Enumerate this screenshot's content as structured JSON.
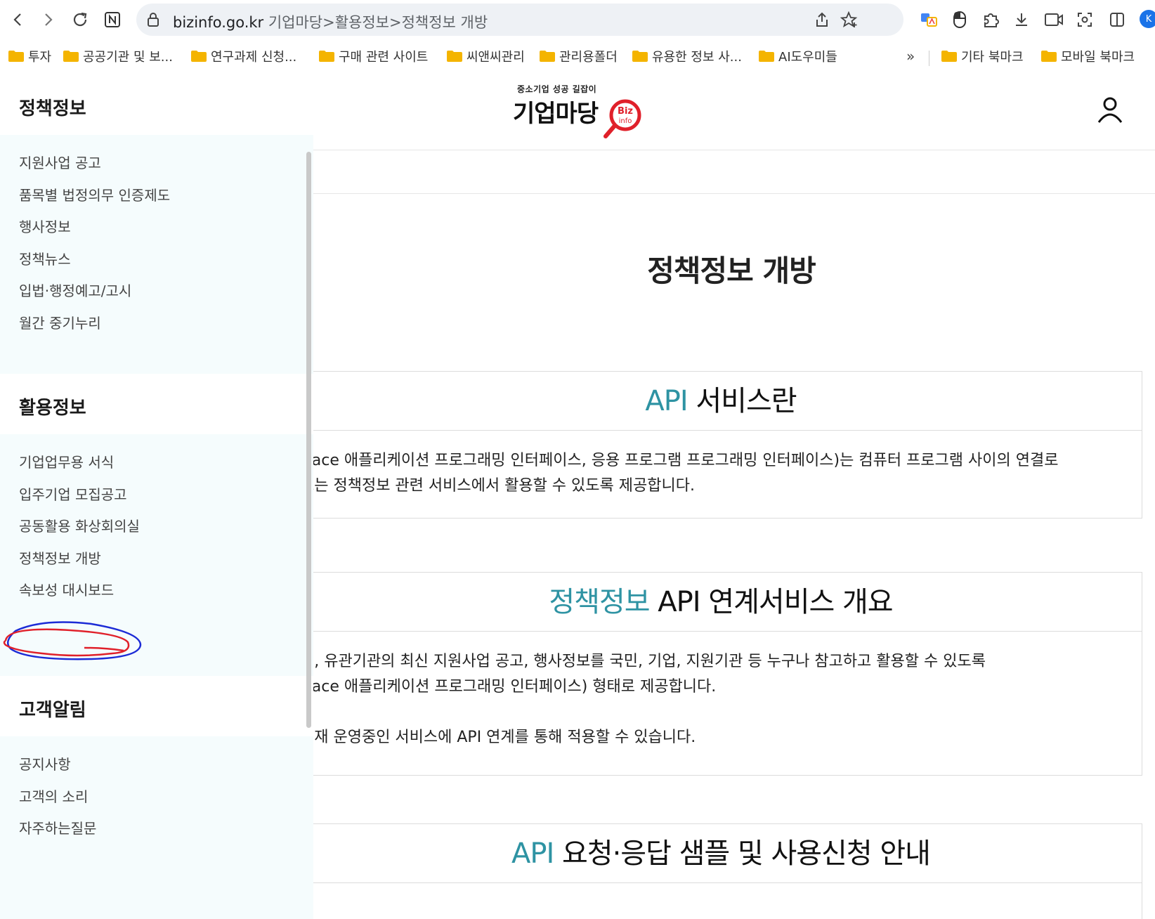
{
  "browser": {
    "url_host": "bizinfo.go.kr",
    "url_path": " 기업마당>활용정보>정책정보 개방",
    "profile_initial": "K",
    "bookmarks": [
      {
        "label": "투자"
      },
      {
        "label": "공공기관 및 보..."
      },
      {
        "label": "연구과제 신청..."
      },
      {
        "label": "구매 관련 사이트"
      },
      {
        "label": "씨앤씨관리"
      },
      {
        "label": "관리용폴더"
      },
      {
        "label": "유용한 정보 사..."
      },
      {
        "label": "AI도우미들"
      }
    ],
    "more_label": "»",
    "other_bookmarks": "기타 북마크",
    "mobile_bookmarks": "모바일 북마크",
    "folder_color": "#f4b400"
  },
  "sidebar": {
    "sections": [
      {
        "title": "정책정보",
        "items": [
          "지원사업 공고",
          "품목별 법정의무 인증제도",
          "행사정보",
          "정책뉴스",
          "입법·행정예고/고시",
          "월간 중기누리"
        ]
      },
      {
        "title": "활용정보",
        "items": [
          "기업업무용 서식",
          "입주기업 모집공고",
          "공동활용 화상회의실",
          "정책정보 개방",
          "속보성 대시보드"
        ]
      },
      {
        "title": "고객알림",
        "items": [
          "공지사항",
          "고객의 소리",
          "자주하는질문"
        ]
      }
    ]
  },
  "header": {
    "logo_tagline": "중소기업 성공 길잡이",
    "logo_name": "기업마당",
    "logo_badge_top": "Biz",
    "logo_badge_bottom": "info"
  },
  "main": {
    "page_title": "정책정보 개방",
    "cards": [
      {
        "title_accent": "API",
        "title_rest": " 서비스란",
        "lines": [
          "rface 애플리케이션 프로그래밍 인터페이스, 응용 프로그램 프로그래밍 인터페이스)는 컴퓨터 프로그램 사이의 연결로",
          " 또는 정책정보 관련 서비스에서 활용할 수 있도록 제공합니다."
        ]
      },
      {
        "title_accent": "정책정보",
        "title_rest": " API 연계서비스 개요",
        "lines": [
          "체, 유관기관의 최신 지원사업 공고, 행사정보를 국민, 기업, 지원기관 등 누구나 참고하고 활용할 수 있도록",
          "rface 애플리케이션 프로그래밍 인터페이스) 형태로 제공합니다.",
          "현재 운영중인 서비스에 API 연계를 통해 적용할 수 있습니다."
        ]
      },
      {
        "title_accent": "API",
        "title_rest": " 요청·응답 샘플 및 사용신청 안내"
      }
    ]
  },
  "colors": {
    "accent": "#2e93a3",
    "sidebar_bg": "#f5fcfd",
    "annotation_red": "#e0202a",
    "annotation_blue": "#1c2bd6"
  }
}
